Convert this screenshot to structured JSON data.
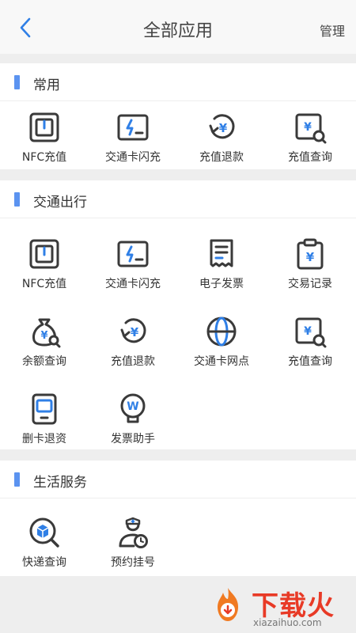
{
  "header": {
    "title": "全部应用",
    "manage_label": "管理"
  },
  "sections": [
    {
      "title": "常用",
      "items": [
        {
          "label": "NFC充值",
          "icon": "nfc-card-icon"
        },
        {
          "label": "交通卡闪充",
          "icon": "flash-charge-icon"
        },
        {
          "label": "充值退款",
          "icon": "refund-icon"
        },
        {
          "label": "充值查询",
          "icon": "recharge-search-icon"
        }
      ]
    },
    {
      "title": "交通出行",
      "items": [
        {
          "label": "NFC充值",
          "icon": "nfc-card-icon"
        },
        {
          "label": "交通卡闪充",
          "icon": "flash-charge-icon"
        },
        {
          "label": "电子发票",
          "icon": "invoice-icon"
        },
        {
          "label": "交易记录",
          "icon": "clipboard-yuan-icon"
        },
        {
          "label": "余额查询",
          "icon": "money-bag-search-icon"
        },
        {
          "label": "充值退款",
          "icon": "refund-icon"
        },
        {
          "label": "交通卡网点",
          "icon": "globe-icon"
        },
        {
          "label": "充值查询",
          "icon": "recharge-search-icon"
        },
        {
          "label": "删卡退资",
          "icon": "phone-card-icon"
        },
        {
          "label": "发票助手",
          "icon": "bulb-w-icon"
        }
      ]
    },
    {
      "title": "生活服务",
      "items": [
        {
          "label": "快递查询",
          "icon": "package-search-icon"
        },
        {
          "label": "预约挂号",
          "icon": "doctor-clock-icon"
        }
      ]
    }
  ],
  "watermark": {
    "text": "下载火",
    "url": "xiazaihuo.com"
  },
  "colors": {
    "accent": "#5b93f0",
    "icon_dark": "#3a3a3a",
    "icon_blue": "#2f7fe6",
    "watermark": "#e83a26"
  }
}
